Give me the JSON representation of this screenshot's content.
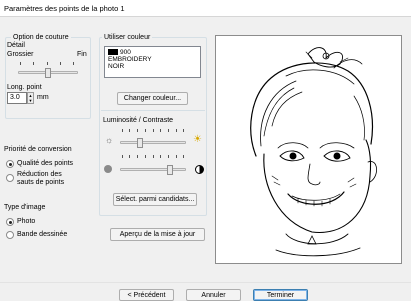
{
  "window": {
    "title": "Paramètres des points de la photo 1"
  },
  "stitch_options": {
    "legend": "Option de couture",
    "detail_label": "Détail",
    "coarse_label": "Grossier",
    "fine_label": "Fin",
    "detail_level": 0.5,
    "length_label": "Long. point",
    "length_value": "3.0",
    "length_unit": "mm"
  },
  "conversion_priority": {
    "label": "Priorité de conversion",
    "options": [
      "Qualité des points",
      "Réduction des\nsauts de points"
    ],
    "selected": 0
  },
  "image_type": {
    "label": "Type d'image",
    "options": [
      "Photo",
      "Bande dessinée"
    ],
    "selected": 0
  },
  "color": {
    "legend": "Utiliser couleur",
    "items": [
      {
        "swatch": "#000000",
        "line1": "900",
        "line2": "EMBROIDERY",
        "line3": "NOIR"
      }
    ],
    "change_button": "Changer couleur..."
  },
  "brightness_contrast": {
    "label": "Luminosité / Contraste",
    "brightness_level": 0.3,
    "contrast_level": 0.75
  },
  "select_button": "Sélect. parmi candidats...",
  "preview_button": "Aperçu de la mise à jour",
  "footer": {
    "prev_button": "< Précédent",
    "cancel_button": "Annuler",
    "finish_button": "Terminer"
  }
}
